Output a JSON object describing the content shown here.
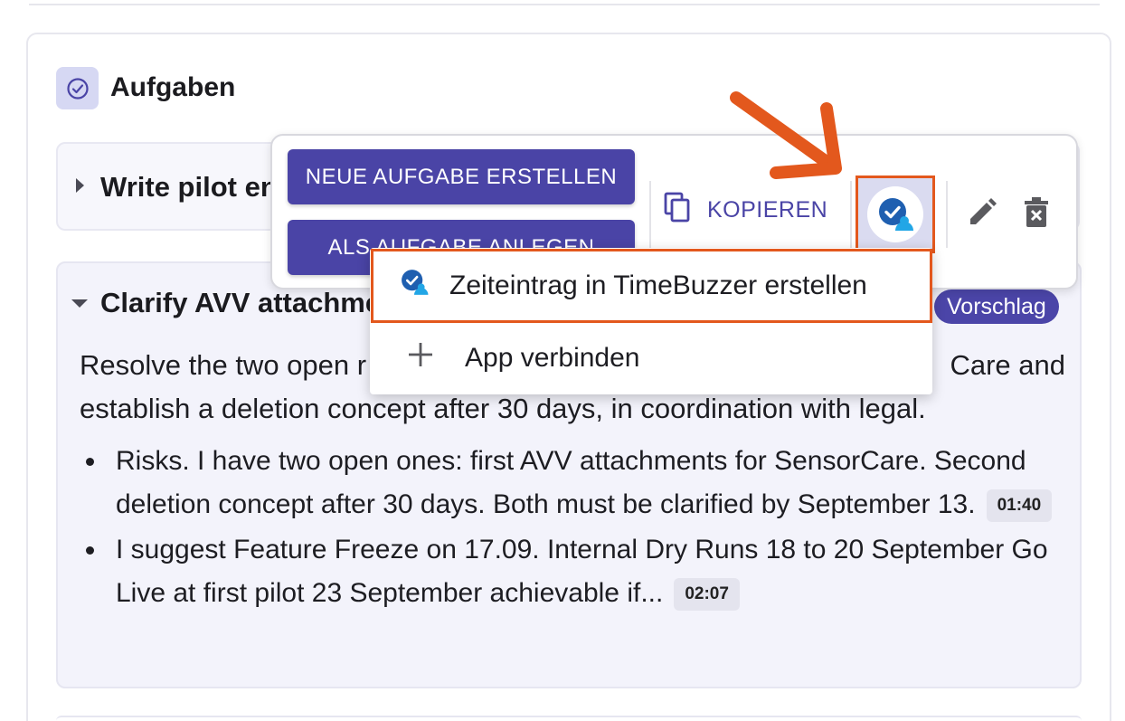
{
  "section": {
    "title": "Aufgaben",
    "icon": "check-circle-icon"
  },
  "tasks": [
    {
      "title": "Write pilot en",
      "expanded": false
    },
    {
      "title": "Clarify AVV attachme",
      "expanded": true,
      "badge": "Vorschlag",
      "description": "Resolve the two open r                                                                                   Care and establish a deletion concept after 30 days, in coordination with legal.",
      "description_parts": {
        "line1_left": "Resolve the two open r",
        "line1_right": "Care and",
        "line2": "establish a deletion concept after 30 days, in coordination with legal."
      },
      "bullets": [
        {
          "text": "Risks. I have two open ones: first AVV attachments for SensorCare. Second deletion concept after 30 days. Both must be clarified by September 13.",
          "timestamp": "01:40"
        },
        {
          "text": "I suggest Feature Freeze on 17.09. Internal Dry Runs 18 to 20 September Go Live at first pilot 23 September achievable if...",
          "timestamp": "02:07"
        }
      ]
    }
  ],
  "toolbar": {
    "new_task_label": "NEUE AUFGABE ERSTELLEN",
    "as_task_label": "ALS AUFGABE ANLEGEN",
    "copy_label": "KOPIEREN",
    "timebuzzer_icon": "timebuzzer-icon",
    "edit_icon": "pencil-icon",
    "delete_icon": "trash-icon"
  },
  "menu": {
    "items": [
      {
        "label": "Zeiteintrag in TimeBuzzer erstellen",
        "icon": "timebuzzer-icon"
      },
      {
        "label": "App verbinden",
        "icon": "plus-icon"
      }
    ]
  },
  "colors": {
    "primary": "#4a44a6",
    "highlight": "#e3581d",
    "timebuzzer_blue": "#1f5fb0",
    "timebuzzer_light": "#22a6e6"
  }
}
